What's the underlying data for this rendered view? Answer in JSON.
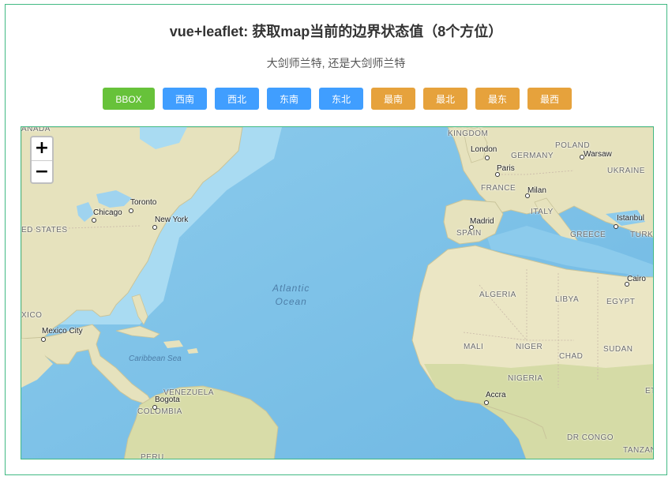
{
  "header": {
    "title": "vue+leaflet: 获取map当前的边界状态值（8个方位）",
    "subtitle": "大剑师兰特, 还是大剑师兰特"
  },
  "buttons": [
    {
      "label": "BBOX",
      "color": "#67c23a"
    },
    {
      "label": "西南",
      "color": "#409eff"
    },
    {
      "label": "西北",
      "color": "#409eff"
    },
    {
      "label": "东南",
      "color": "#409eff"
    },
    {
      "label": "东北",
      "color": "#409eff"
    },
    {
      "label": "最南",
      "color": "#e6a23c"
    },
    {
      "label": "最北",
      "color": "#e6a23c"
    },
    {
      "label": "最东",
      "color": "#e6a23c"
    },
    {
      "label": "最西",
      "color": "#e6a23c"
    }
  ],
  "map": {
    "zoom_in": "+",
    "zoom_out": "−",
    "cities": {
      "london": "London",
      "paris": "Paris",
      "warsaw": "Warsaw",
      "milan": "Milan",
      "madrid": "Madrid",
      "istanbul": "Istanbul",
      "cairo": "Cairo",
      "toronto": "Toronto",
      "chicago": "Chicago",
      "newyork": "New York",
      "mexicocity": "Mexico City",
      "bogota": "Bogota",
      "accra": "Accra"
    },
    "countries": {
      "canada": "ANADA",
      "us": "ED STATES",
      "mexico": "XICO",
      "uk": "UNITED\nKINGDOM",
      "poland": "POLAND",
      "germany": "GERMANY",
      "ukraine": "UKRAINE",
      "france": "FRANCE",
      "italy": "ITALY",
      "spain": "SPAIN",
      "greece": "GREECE",
      "turkey": "TURK",
      "algeria": "ALGERIA",
      "libya": "LIBYA",
      "egypt": "EGYPT",
      "mali": "MALI",
      "niger": "NIGER",
      "chad": "CHAD",
      "sudan": "SUDAN",
      "nigeria": "NIGERIA",
      "venezuela": "VENEZUELA",
      "colombia": "COLOMBIA",
      "peru": "PERU",
      "drcongo": "DR CONGO",
      "tanzania": "TANZAN",
      "ethiopia": "ET"
    },
    "oceans": {
      "atlantic": "Atlantic\nOcean",
      "caribbean": "Caribbean Sea"
    }
  },
  "colors": {
    "accent_border": "#42b983",
    "water": "#9fd3ef",
    "land": "#e8e4c0"
  }
}
